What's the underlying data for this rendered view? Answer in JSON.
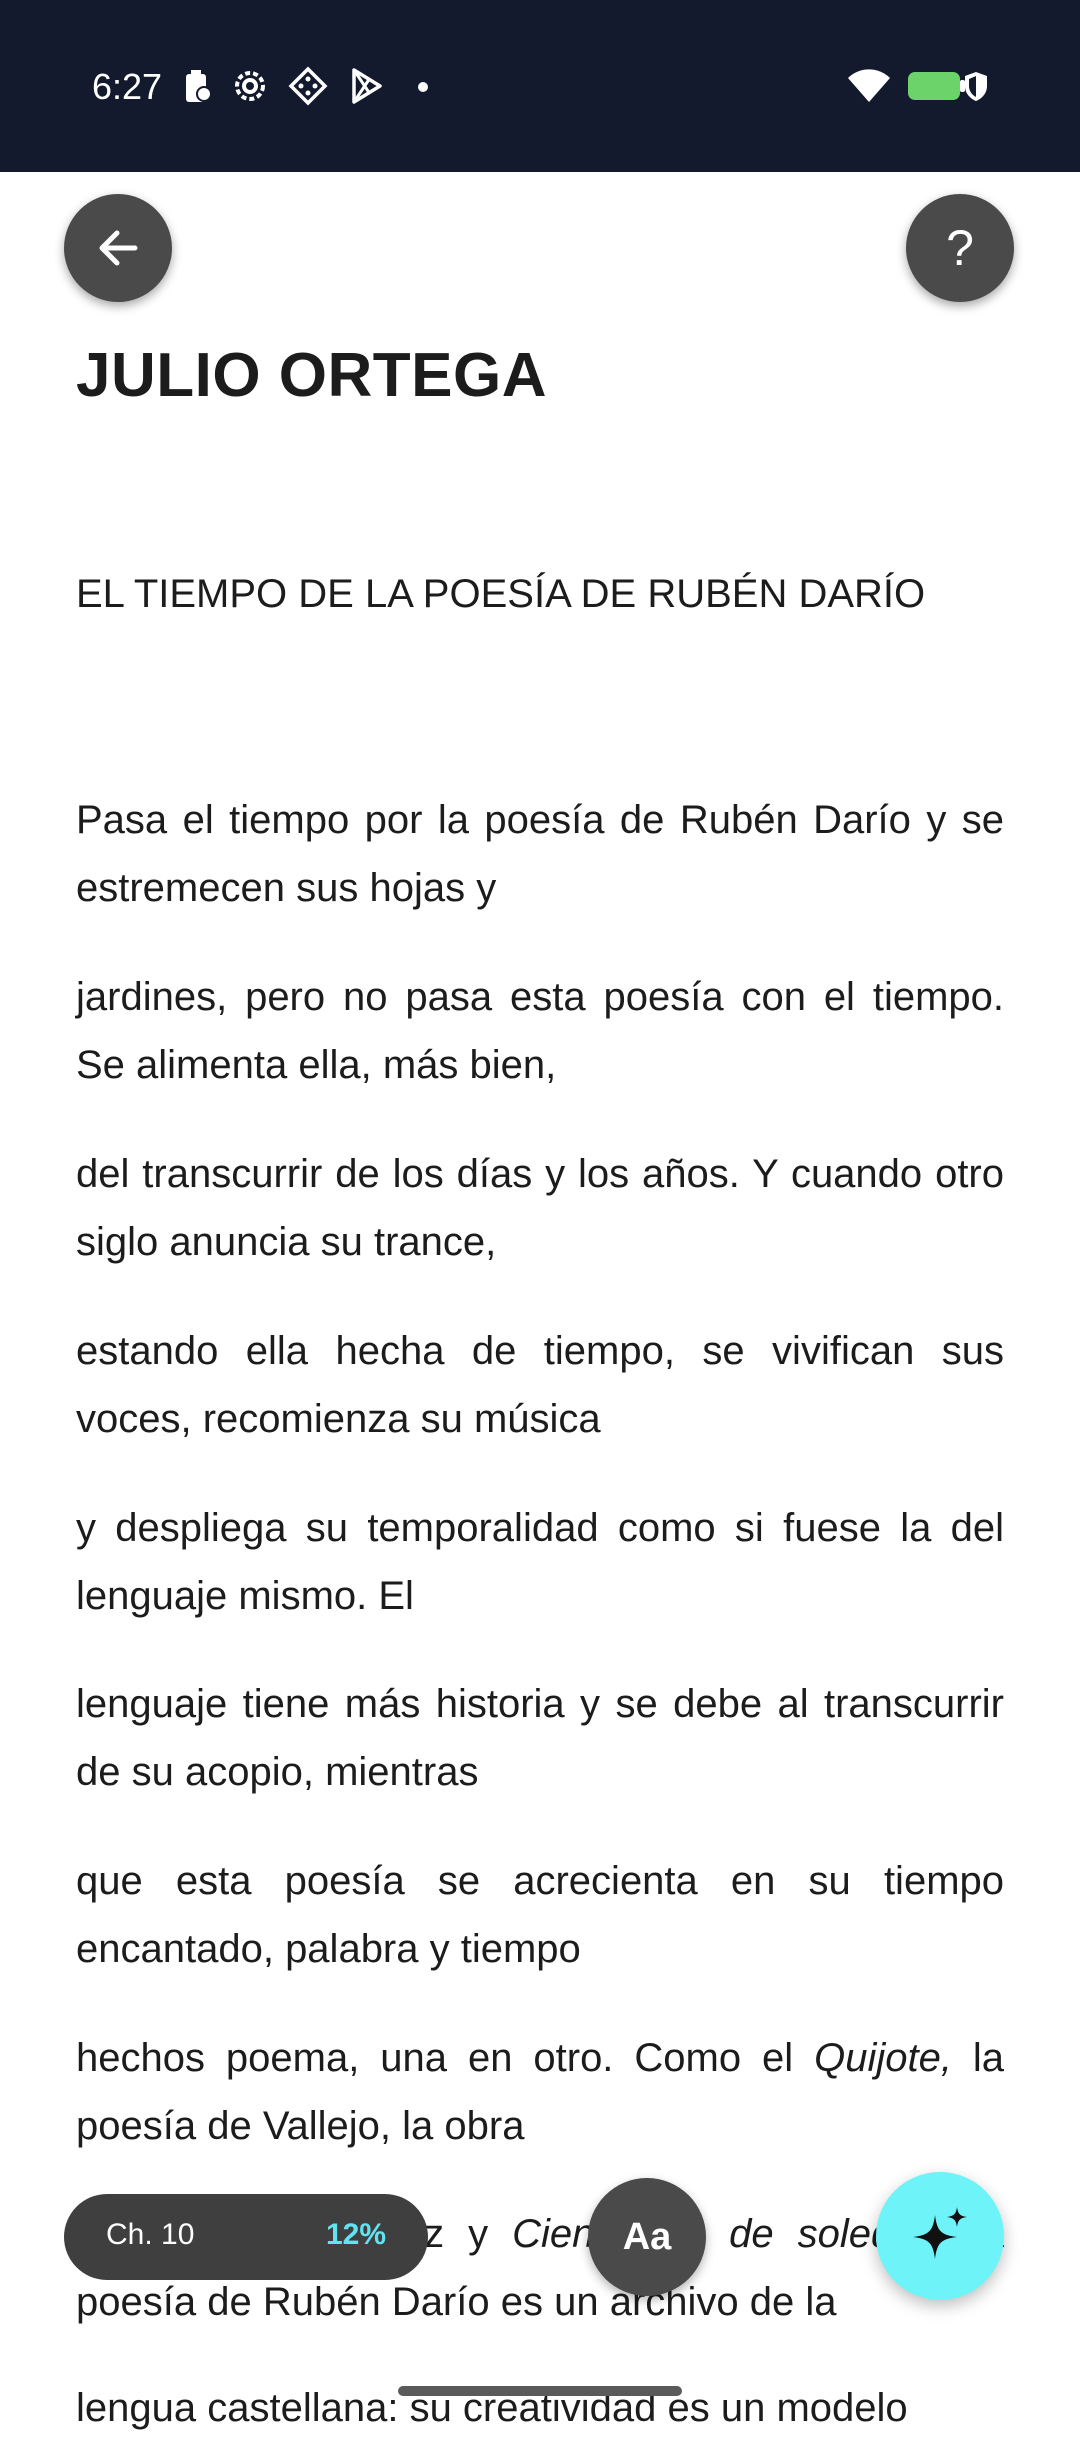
{
  "status_bar": {
    "time": "6:27",
    "icons": [
      "battery-saver-icon",
      "settings-icon",
      "game-icon",
      "play-store-icon",
      "more-dot",
      "wifi-icon",
      "battery-icon",
      "vpn-shield-icon"
    ]
  },
  "header": {
    "back_icon": "arrow-left-icon",
    "help_label": "?"
  },
  "book": {
    "author": "JULIO ORTEGA",
    "chapter_title": "EL TIEMPO DE LA POESÍA DE RUBÉN DARÍO",
    "paragraphs": [
      "Pasa el tiempo por la poesía de Rubén Darío y se estremecen sus hojas y",
      "jardines, pero no pasa esta poesía con el tiempo. Se alimenta ella, más bien,",
      "del transcurrir de los días y los años. Y cuando otro siglo anuncia su trance,",
      "estando ella hecha de tiempo, se vivifican sus voces, recomienza su música",
      "y despliega su temporalidad como si fuese la del lenguaje mismo. El",
      "lenguaje tiene más historia y se debe al transcurrir de su acopio, mientras",
      "que esta poesía se acrecienta en su tiempo encantado, palabra y tiempo"
    ],
    "p8": {
      "before": "hechos poema, una en otro. Como el ",
      "italic": "Quijote,",
      "after": " la poesía de Vallejo, la obra"
    },
    "p9": {
      "start": "de García Márquez y ",
      "italic": "Cien años de soledad,",
      "after": " la poesía de Rubén Darío es un archivo de la"
    },
    "p10": "lengua castellana: su creatividad es un modelo"
  },
  "bottom_bar": {
    "chapter": "Ch. 10",
    "progress": "12%",
    "font_button": "Aa",
    "ai_icon": "sparkle-icon"
  },
  "colors": {
    "status_bar_bg": "#131a2e",
    "button_bg": "#4a4a4a",
    "accent_cyan": "#6ef3f8",
    "progress_text": "#61e3f2"
  }
}
